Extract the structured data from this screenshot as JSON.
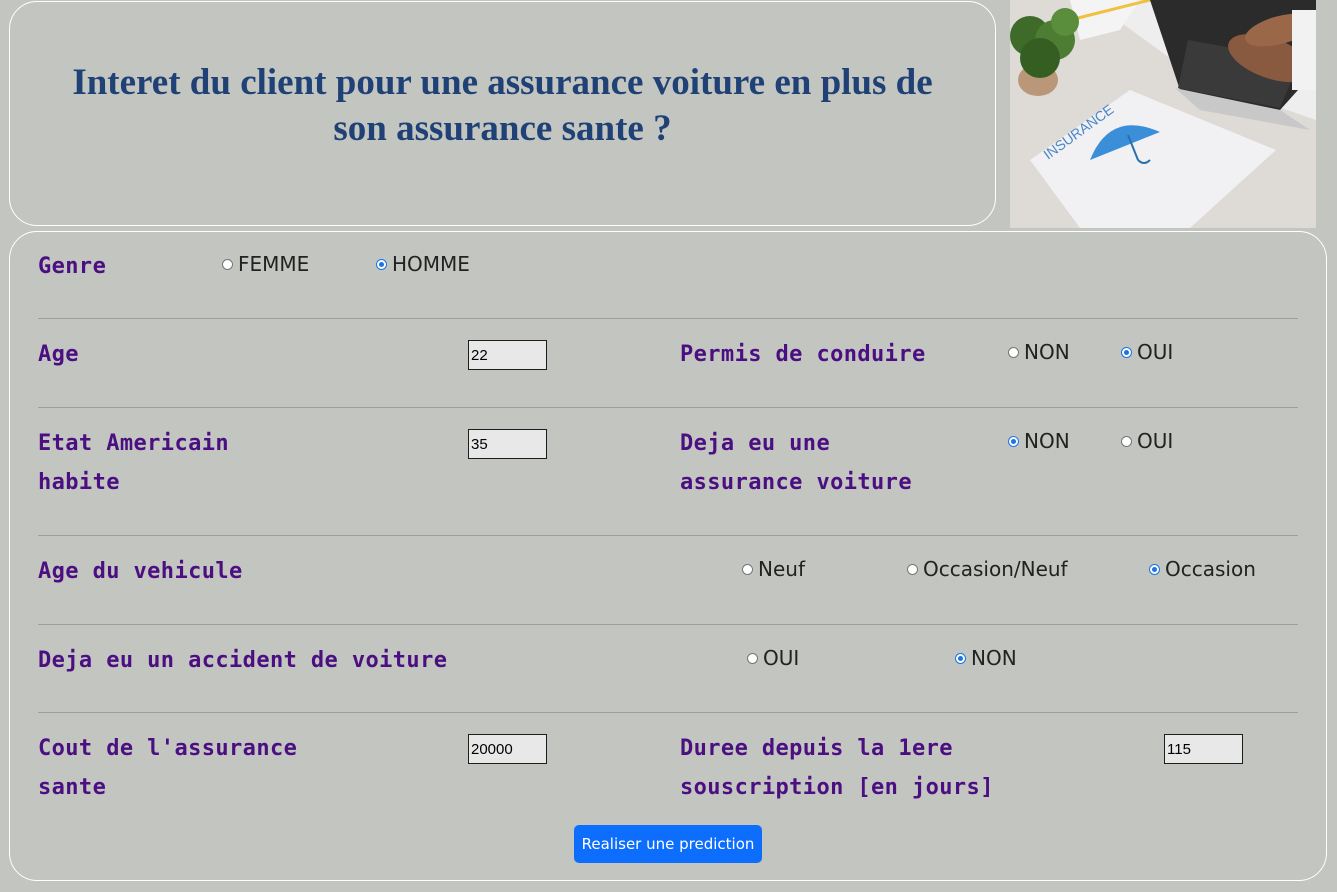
{
  "header": {
    "title": "Interet du client pour une assurance voiture en plus de son assurance sante ?"
  },
  "hero_image": {
    "sheet_text": "INSURANCE",
    "alt": "insurance-photo"
  },
  "form": {
    "genre": {
      "label": "Genre",
      "options": [
        "FEMME",
        "HOMME"
      ],
      "selected": "HOMME"
    },
    "age": {
      "label": "Age",
      "value": "22"
    },
    "permis": {
      "label": "Permis de conduire",
      "options": [
        "NON",
        "OUI"
      ],
      "selected": "OUI"
    },
    "etat": {
      "label_line1": "Etat Americain",
      "label_line2": "habite",
      "value": "35"
    },
    "deja_assurance": {
      "label_line1": "Deja eu une",
      "label_line2": "assurance voiture",
      "options": [
        "NON",
        "OUI"
      ],
      "selected": "NON"
    },
    "age_vehicule": {
      "label": "Age du vehicule",
      "options": [
        "Neuf",
        "Occasion/Neuf",
        "Occasion"
      ],
      "selected": "Occasion"
    },
    "accident": {
      "label": "Deja eu un accident de voiture",
      "options": [
        "OUI",
        "NON"
      ],
      "selected": "NON"
    },
    "cout": {
      "label_line1": "Cout de l'assurance",
      "label_line2": "sante",
      "value": "20000"
    },
    "duree": {
      "label_line1": "Duree depuis la 1ere",
      "label_line2": "souscription [en jours]",
      "value": "115"
    },
    "submit_label": "Realiser une prediction"
  },
  "colors": {
    "background": "#c3c6c0",
    "title": "#1f4176",
    "label": "#4b0f82",
    "button": "#0d6efd"
  }
}
